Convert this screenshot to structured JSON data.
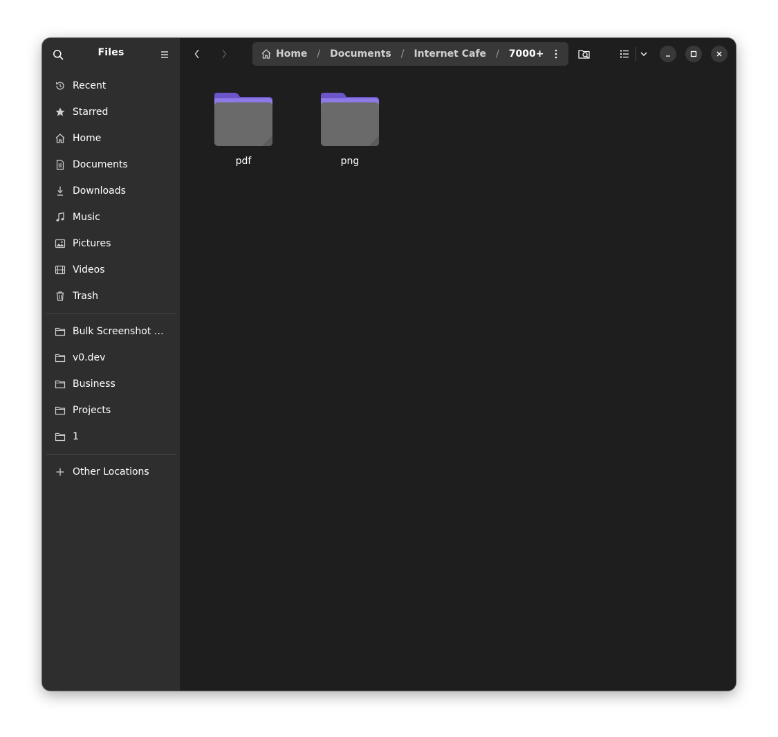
{
  "sidebar": {
    "title": "Files",
    "places": [
      {
        "label": "Recent",
        "icon": "clock-icon"
      },
      {
        "label": "Starred",
        "icon": "star-icon"
      },
      {
        "label": "Home",
        "icon": "home-icon"
      },
      {
        "label": "Documents",
        "icon": "document-icon"
      },
      {
        "label": "Downloads",
        "icon": "download-icon"
      },
      {
        "label": "Music",
        "icon": "music-icon"
      },
      {
        "label": "Pictures",
        "icon": "picture-icon"
      },
      {
        "label": "Videos",
        "icon": "video-icon"
      },
      {
        "label": "Trash",
        "icon": "trash-icon"
      }
    ],
    "bookmarks": [
      {
        "label": "Bulk Screenshot B…",
        "icon": "folder-icon"
      },
      {
        "label": "v0.dev",
        "icon": "folder-icon"
      },
      {
        "label": "Business",
        "icon": "folder-icon"
      },
      {
        "label": "Projects",
        "icon": "folder-icon"
      },
      {
        "label": "1",
        "icon": "folder-icon"
      }
    ],
    "other": {
      "label": "Other Locations",
      "icon": "plus-icon"
    }
  },
  "pathbar": {
    "crumbs": [
      "Home",
      "Documents",
      "Internet Cafe",
      "7000+"
    ]
  },
  "files": [
    {
      "name": "pdf",
      "type": "folder"
    },
    {
      "name": "png",
      "type": "folder"
    }
  ],
  "colors": {
    "sidebar_bg": "#2e2e2e",
    "content_bg": "#1e1e1e",
    "folder_tab": "#7764d8",
    "folder_body": "#6a6a6a"
  }
}
